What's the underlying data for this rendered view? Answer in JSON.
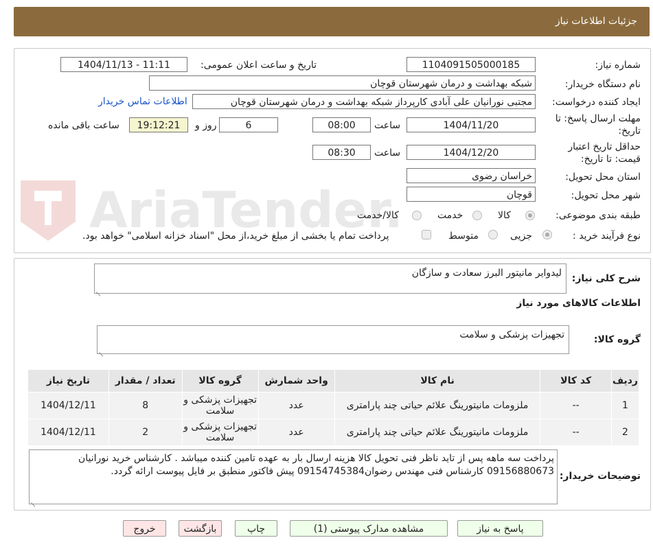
{
  "header": {
    "title": "جزئیات اطلاعات نیاز"
  },
  "watermark": {
    "text": "AriaTender.neT"
  },
  "fields": {
    "need_number_label": "شماره نیاز:",
    "need_number": "1104091505000185",
    "announce_label": "تاریخ و ساعت اعلان عمومی:",
    "announce_value": "1404/11/13 - 11:11",
    "buyer_org_label": "نام دستگاه خریدار:",
    "buyer_org": "شبکه بهداشت و درمان شهرستان قوچان",
    "creator_label": "ایجاد کننده درخواست:",
    "creator": "مجتبی نورانیان علی آبادی کارپرداز شبکه بهداشت و درمان شهرستان قوچان",
    "contact_link": "اطلاعات تماس خریدار",
    "send_deadline_label_1": "مهلت ارسال پاسخ: تا",
    "send_deadline_label_2": "تاریخ:",
    "send_date": "1404/11/20",
    "time_label": "ساعت",
    "send_time": "08:00",
    "days": "6",
    "days_label": "روز و",
    "remaining_time": "19:12:21",
    "remaining_label": "ساعت باقی مانده",
    "validity_label_1": "حداقل تاریخ اعتبار",
    "validity_label_2": "قیمت: تا تاریخ:",
    "validity_date": "1404/12/20",
    "validity_time": "08:30",
    "province_label": "استان محل تحویل:",
    "province": "خراسان رضوی",
    "city_label": "شهر محل تحویل:",
    "city": "قوچان",
    "category_label": "طبقه بندی موضوعی:",
    "category_options": [
      "کالا",
      "خدمت",
      "کالا/خدمت"
    ],
    "process_label": "نوع فرآیند خرید :",
    "process_options": [
      "جزیی",
      "متوسط"
    ],
    "treasury_text": "پرداخت تمام یا بخشی از مبلغ خرید،از محل \"اسناد خزانه اسلامی\" خواهد بود."
  },
  "details": {
    "summary_label": "شرح کلی نیاز:",
    "summary": "لیدوایر مانیتور البرز سعادت و سازگان",
    "goods_info_title": "اطلاعات کالاهای مورد نیاز",
    "goods_group_label": "گروه کالا:",
    "goods_group": "تجهیزات پزشکی و سلامت"
  },
  "table": {
    "headers": [
      "ردیف",
      "کد کالا",
      "نام کالا",
      "واحد شمارش",
      "گروه کالا",
      "تعداد / مقدار",
      "تاریخ نیاز"
    ],
    "rows": [
      [
        "1",
        "--",
        "ملزومات مانیتورینگ علائم حیاتی چند پارامتری",
        "عدد",
        "تجهیزات پزشکی و سلامت",
        "8",
        "1404/12/11"
      ],
      [
        "2",
        "--",
        "ملزومات مانیتورینگ علائم حیاتی چند پارامتری",
        "عدد",
        "تجهیزات پزشکی و سلامت",
        "2",
        "1404/12/11"
      ]
    ]
  },
  "buyer_notes": {
    "label": "توضیحات خریدار:",
    "text": "پرداخت سه ماهه پس از تاید ناظر فنی تحویل کالا هزینه ارسال بار به عهده تامین کننده میباشد . کارشناس خرید نورانیان 09156880673 کارشناس فنی مهندس رضوان09154745384 پیش فاکتور منطبق بر فایل پیوست ارائه گردد."
  },
  "buttons": {
    "reply": "پاسخ به نیاز",
    "view_docs": "مشاهده مدارک پیوستی (1)",
    "print": "چاپ",
    "back": "بازگشت",
    "exit": "خروج"
  }
}
